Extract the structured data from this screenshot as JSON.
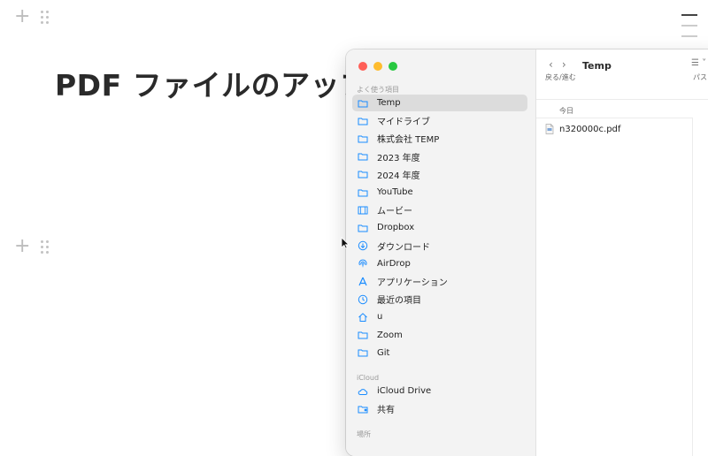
{
  "page": {
    "title": "PDF ファイルのアップ"
  },
  "finder": {
    "traffic_colors": [
      "#ff5f57",
      "#febc2e",
      "#28c840"
    ],
    "favorites_label": "よく使う項目",
    "favorites": [
      {
        "label": "Temp",
        "icon": "folder-icon",
        "selected": true
      },
      {
        "label": "マイドライブ",
        "icon": "folder-icon"
      },
      {
        "label": "株式会社 TEMP",
        "icon": "folder-icon"
      },
      {
        "label": "2023 年度",
        "icon": "folder-icon"
      },
      {
        "label": "2024 年度",
        "icon": "folder-icon"
      },
      {
        "label": "YouTube",
        "icon": "folder-icon"
      },
      {
        "label": "ムービー",
        "icon": "film-icon"
      },
      {
        "label": "Dropbox",
        "icon": "folder-icon"
      },
      {
        "label": "ダウンロード",
        "icon": "download-icon"
      },
      {
        "label": "AirDrop",
        "icon": "airdrop-icon"
      },
      {
        "label": "アプリケーション",
        "icon": "applications-icon"
      },
      {
        "label": "最近の項目",
        "icon": "clock-icon"
      },
      {
        "label": "u",
        "icon": "home-icon"
      },
      {
        "label": "Zoom",
        "icon": "folder-icon"
      },
      {
        "label": "Git",
        "icon": "folder-icon"
      }
    ],
    "icloud_label": "iCloud",
    "icloud": [
      {
        "label": "iCloud Drive",
        "icon": "cloud-icon"
      },
      {
        "label": "共有",
        "icon": "shared-folder-icon"
      }
    ],
    "locations_label": "場所",
    "toolbar": {
      "back_forward_label": "戻る/進む",
      "folder_title": "Temp",
      "path_label": "パス"
    },
    "group_label": "今日",
    "files": [
      {
        "name": "n320000c.pdf",
        "icon": "pdf-file-icon"
      }
    ]
  },
  "colors": {
    "accent": "#1a8cff",
    "sidebar_bg": "#f3f3f3",
    "selection": "#dcdcdc"
  }
}
